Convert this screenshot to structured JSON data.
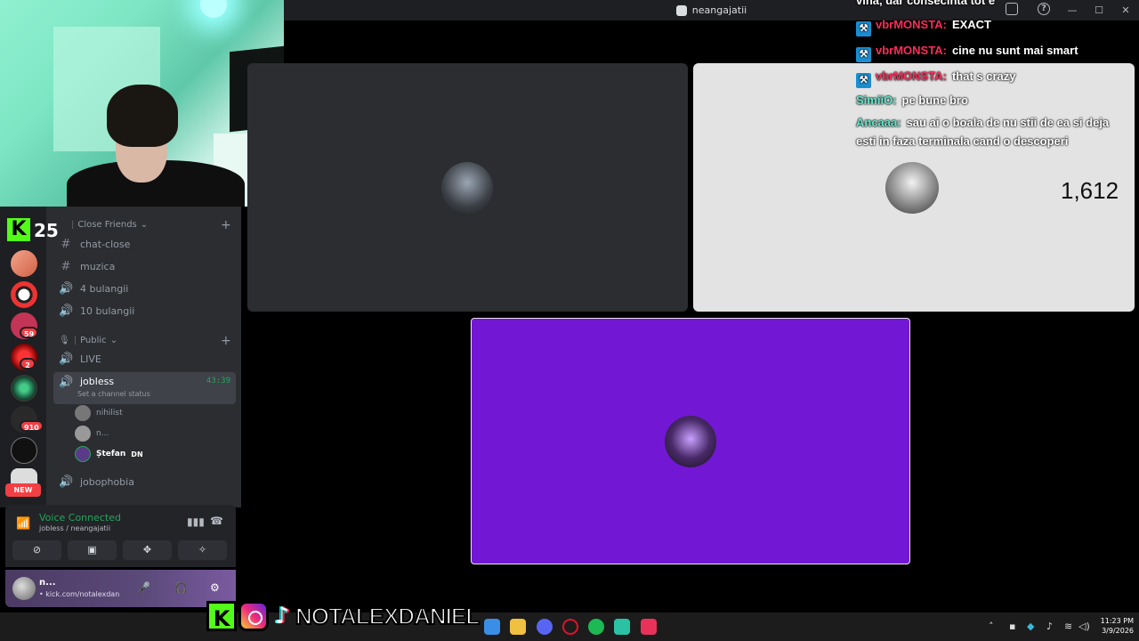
{
  "window": {
    "title": "neangajatii"
  },
  "chat": {
    "messages": [
      {
        "user": "vbrMONSTA:",
        "text": "EXACT",
        "color": "#ff2b5a",
        "mod": true
      },
      {
        "user": "vbrMONSTA:",
        "text": "cine nu sunt mai smart",
        "color": "#ff2b5a",
        "mod": true
      },
      {
        "user": "vbrMONSTA:",
        "text": "that s crazy",
        "color": "#ff2b5a",
        "mod": true
      },
      {
        "user": "SimiiO:",
        "text": "pe bune bro",
        "color": "#5ee6c9",
        "mod": false
      },
      {
        "user": "Ancaaa:",
        "text": "sau ai o boala de nu stii de ea si deja esti in faza terminala cand o descoperi",
        "color": "#5ee6c9",
        "mod": false
      }
    ],
    "partial_top": "vina, dar consecinta tot e"
  },
  "kick": {
    "count": "25"
  },
  "viewer_count": "1,612",
  "servers": [
    {
      "badge": ""
    },
    {
      "badge": ""
    },
    {
      "badge": "59"
    },
    {
      "badge": "2"
    },
    {
      "badge": ""
    },
    {
      "badge": "910"
    },
    {
      "badge": ""
    }
  ],
  "server_new_label": "NEW",
  "categories": {
    "close_friends": "Close Friends",
    "public": "Public"
  },
  "channels": {
    "chat_close": "chat-close",
    "muzica": "muzica",
    "bulangii4": "4 bulangii",
    "bulangii10": "10 bulangii",
    "live": "LIVE",
    "jobless": "jobless",
    "jobless_timer": "43:39",
    "jobless_status": "Set a channel status",
    "jobophobia": "jobophobia"
  },
  "members": [
    {
      "name": "nihilist"
    },
    {
      "name": "n..."
    },
    {
      "name": "Ștefan",
      "tag": "DN"
    }
  ],
  "voice": {
    "title": "Voice Connected",
    "subtitle": "jobless / neangajatii"
  },
  "user": {
    "name": "n...",
    "status": "• kick.com/notalexdan"
  },
  "social": {
    "handle": "NOTALEXDANIEL"
  },
  "clock": {
    "time": "11:23 PM",
    "date": "3/9/2026"
  },
  "colors": {
    "accent_green": "#23a55a",
    "tile_purple": "#7218d4",
    "kick_green": "#53fc18"
  }
}
